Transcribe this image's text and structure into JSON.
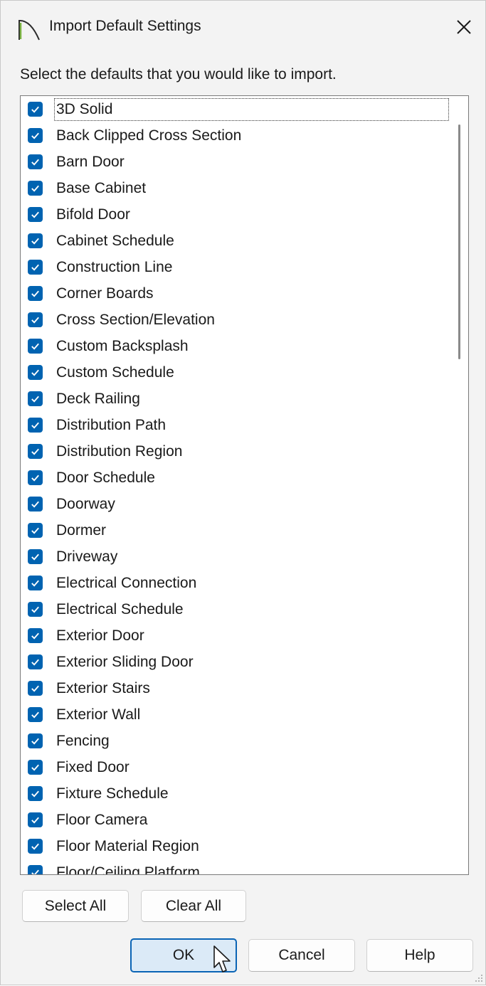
{
  "window": {
    "title": "Import Default Settings",
    "app_icon": "arc-logo-icon",
    "close_icon": "close-icon"
  },
  "instruction": "Select the defaults that you would like to import.",
  "list": {
    "items": [
      {
        "label": "3D Solid",
        "checked": true
      },
      {
        "label": "Back Clipped Cross Section",
        "checked": true
      },
      {
        "label": "Barn Door",
        "checked": true
      },
      {
        "label": "Base Cabinet",
        "checked": true
      },
      {
        "label": "Bifold Door",
        "checked": true
      },
      {
        "label": "Cabinet Schedule",
        "checked": true
      },
      {
        "label": "Construction Line",
        "checked": true
      },
      {
        "label": "Corner Boards",
        "checked": true
      },
      {
        "label": "Cross Section/Elevation",
        "checked": true
      },
      {
        "label": "Custom Backsplash",
        "checked": true
      },
      {
        "label": "Custom Schedule",
        "checked": true
      },
      {
        "label": "Deck Railing",
        "checked": true
      },
      {
        "label": "Distribution Path",
        "checked": true
      },
      {
        "label": "Distribution Region",
        "checked": true
      },
      {
        "label": "Door Schedule",
        "checked": true
      },
      {
        "label": "Doorway",
        "checked": true
      },
      {
        "label": "Dormer",
        "checked": true
      },
      {
        "label": "Driveway",
        "checked": true
      },
      {
        "label": "Electrical Connection",
        "checked": true
      },
      {
        "label": "Electrical Schedule",
        "checked": true
      },
      {
        "label": "Exterior Door",
        "checked": true
      },
      {
        "label": "Exterior Sliding Door",
        "checked": true
      },
      {
        "label": "Exterior Stairs",
        "checked": true
      },
      {
        "label": "Exterior Wall",
        "checked": true
      },
      {
        "label": "Fencing",
        "checked": true
      },
      {
        "label": "Fixed Door",
        "checked": true
      },
      {
        "label": "Fixture Schedule",
        "checked": true
      },
      {
        "label": "Floor Camera",
        "checked": true
      },
      {
        "label": "Floor Material Region",
        "checked": true
      },
      {
        "label": "Floor/Ceiling Platform",
        "checked": true
      }
    ]
  },
  "buttons": {
    "select_all": "Select All",
    "clear_all": "Clear All",
    "ok": "OK",
    "cancel": "Cancel",
    "help": "Help"
  },
  "colors": {
    "checkbox_accent": "#0063b1",
    "primary_button_border": "#0a64b5"
  }
}
